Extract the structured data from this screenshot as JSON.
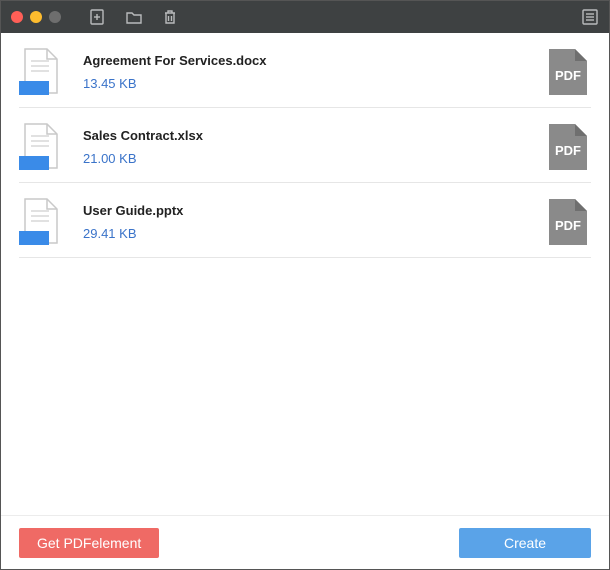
{
  "colors": {
    "accent_blue": "#5aa3e8",
    "accent_red": "#ef6a65",
    "link_blue": "#3a73c9",
    "pdf_grey": "#8a8a8a",
    "doc_accent": "#3a8be8"
  },
  "files": [
    {
      "name": "Agreement For Services.docx",
      "size": "13.45 KB",
      "target_label": "PDF"
    },
    {
      "name": "Sales Contract.xlsx",
      "size": "21.00 KB",
      "target_label": "PDF"
    },
    {
      "name": "User Guide.pptx",
      "size": "29.41 KB",
      "target_label": "PDF"
    }
  ],
  "footer": {
    "get_label": "Get PDFelement",
    "create_label": "Create"
  },
  "toolbar": {
    "add_icon": "add-file",
    "folder_icon": "folder",
    "trash_icon": "trash",
    "list_icon": "list"
  }
}
